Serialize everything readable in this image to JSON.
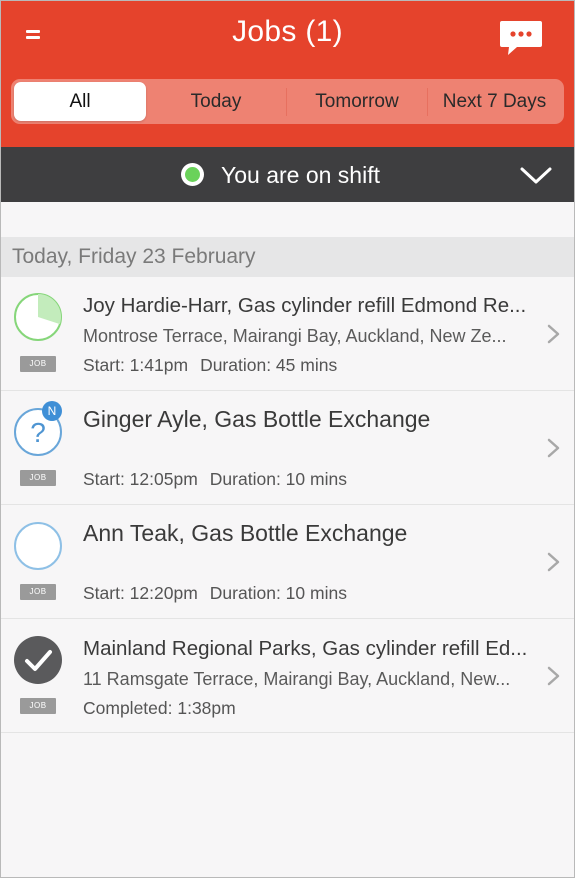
{
  "header": {
    "title": "Jobs (1)",
    "menu_icon": "hamburger-icon",
    "chat_icon": "chat-bubble-icon",
    "color": "#e5432c"
  },
  "tabs": [
    {
      "label": "All",
      "active": true
    },
    {
      "label": "Today",
      "active": false
    },
    {
      "label": "Tomorrow",
      "active": false
    },
    {
      "label": "Next 7 Days",
      "active": false
    }
  ],
  "shift": {
    "text": "You are on shift",
    "status_color": "#6ad25a"
  },
  "date_header": "Today, Friday 23 February",
  "jobs": [
    {
      "title": "Joy Hardie-Harr, Gas cylinder refill Edmond Re...",
      "address": "Montrose Terrace, Mairangi Bay, Auckland, New Ze...",
      "start_label": "Start: 1:41pm",
      "duration_label": "Duration: 45 mins",
      "tag": "JOB",
      "status": "in-progress",
      "progress_fraction": 0.2
    },
    {
      "title": "Ginger Ayle, Gas Bottle Exchange",
      "address": "",
      "start_label": "Start: 12:05pm",
      "duration_label": "Duration: 10 mins",
      "tag": "JOB",
      "status": "unknown",
      "badge": "N"
    },
    {
      "title": "Ann Teak, Gas Bottle Exchange",
      "address": "",
      "start_label": "Start: 12:20pm",
      "duration_label": "Duration: 10 mins",
      "tag": "JOB",
      "status": "pending"
    },
    {
      "title": "Mainland Regional Parks, Gas cylinder refill Ed...",
      "address": "11 Ramsgate Terrace, Mairangi Bay, Auckland, New...",
      "completed_label": "Completed: 1:38pm",
      "tag": "JOB",
      "status": "completed"
    }
  ]
}
